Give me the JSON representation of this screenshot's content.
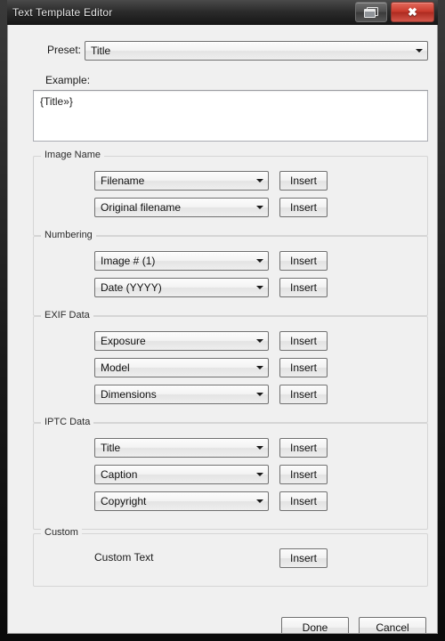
{
  "window": {
    "title": "Text Template Editor",
    "restore_button": "restore-window",
    "close_button": "✖"
  },
  "preset": {
    "label": "Preset:",
    "value": "Title"
  },
  "example": {
    "label": "Example:",
    "value": "{Title»}"
  },
  "insert_label": "Insert",
  "groups": [
    {
      "legend": "Image Name",
      "rows": [
        {
          "value": "Filename",
          "button": "Insert"
        },
        {
          "value": "Original filename",
          "button": "Insert"
        }
      ]
    },
    {
      "legend": "Numbering",
      "rows": [
        {
          "value": "Image # (1)",
          "button": "Insert"
        },
        {
          "value": "Date (YYYY)",
          "button": "Insert"
        }
      ]
    },
    {
      "legend": "EXIF Data",
      "rows": [
        {
          "value": "Exposure",
          "button": "Insert"
        },
        {
          "value": "Model",
          "button": "Insert"
        },
        {
          "value": "Dimensions",
          "button": "Insert"
        }
      ]
    },
    {
      "legend": "IPTC Data",
      "rows": [
        {
          "value": "Title",
          "button": "Insert"
        },
        {
          "value": "Caption",
          "button": "Insert"
        },
        {
          "value": "Copyright",
          "button": "Insert"
        }
      ]
    },
    {
      "legend": "Custom",
      "static_label": "Custom Text",
      "rows": [
        {
          "value": null,
          "button": "Insert"
        }
      ]
    }
  ],
  "footer": {
    "done_label": "Done",
    "cancel_label": "Cancel"
  },
  "colors": {
    "frame": "#1a1a1a",
    "client_bg": "#f0f0f0",
    "close_red": "#c9392c",
    "field_bg": "#ffffff"
  }
}
